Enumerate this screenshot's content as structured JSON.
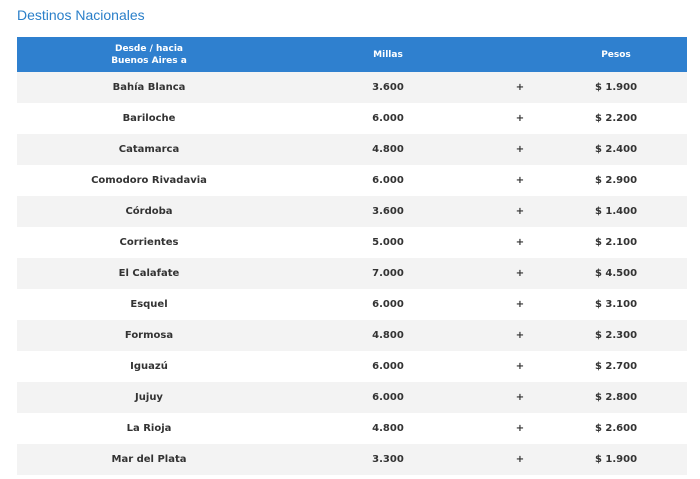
{
  "page": {
    "title": "Destinos Nacionales"
  },
  "table": {
    "headers": {
      "destino_line1": "Desde / hacia",
      "destino_line2": "Buenos Aires a",
      "millas": "Millas",
      "pesos": "Pesos"
    },
    "rows": [
      {
        "destino": "Bahía Blanca",
        "millas": "3.600",
        "plus": "+",
        "pesos": "$ 1.900"
      },
      {
        "destino": "Bariloche",
        "millas": "6.000",
        "plus": "+",
        "pesos": "$ 2.200"
      },
      {
        "destino": "Catamarca",
        "millas": "4.800",
        "plus": "+",
        "pesos": "$ 2.400"
      },
      {
        "destino": "Comodoro Rivadavia",
        "millas": "6.000",
        "plus": "+",
        "pesos": "$ 2.900"
      },
      {
        "destino": "Córdoba",
        "millas": "3.600",
        "plus": "+",
        "pesos": "$ 1.400"
      },
      {
        "destino": "Corrientes",
        "millas": "5.000",
        "plus": "+",
        "pesos": "$ 2.100"
      },
      {
        "destino": "El Calafate",
        "millas": "7.000",
        "plus": "+",
        "pesos": "$ 4.500"
      },
      {
        "destino": "Esquel",
        "millas": "6.000",
        "plus": "+",
        "pesos": "$ 3.100"
      },
      {
        "destino": "Formosa",
        "millas": "4.800",
        "plus": "+",
        "pesos": "$ 2.300"
      },
      {
        "destino": "Iguazú",
        "millas": "6.000",
        "plus": "+",
        "pesos": "$ 2.700"
      },
      {
        "destino": "Jujuy",
        "millas": "6.000",
        "plus": "+",
        "pesos": "$ 2.800"
      },
      {
        "destino": "La Rioja",
        "millas": "4.800",
        "plus": "+",
        "pesos": "$ 2.600"
      },
      {
        "destino": "Mar del Plata",
        "millas": "3.300",
        "plus": "+",
        "pesos": "$ 1.900"
      }
    ]
  },
  "colors": {
    "title": "#2a7fc9",
    "header_bg": "#2f80cf",
    "row_alt_bg": "#f3f3f3"
  }
}
